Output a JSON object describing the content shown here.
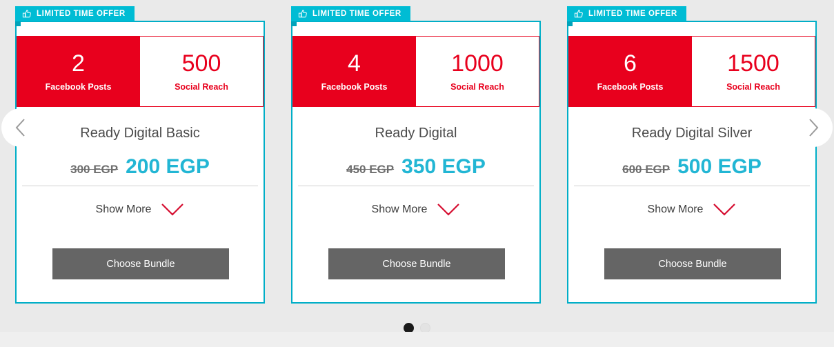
{
  "page": {
    "background_color": "#eaeaea",
    "accent_cyan": "#00aec7",
    "accent_red": "#e8001d",
    "price_color": "#22b6d4",
    "button_color": "#656565"
  },
  "carousel": {
    "prev_label": "Previous",
    "prev_icon": "chevron-left-icon",
    "next_label": "Next",
    "next_icon": "chevron-right-icon",
    "dots": [
      {
        "state": "active"
      },
      {
        "state": "inactive"
      }
    ]
  },
  "ribbon": {
    "label": "LIMITED TIME OFFER",
    "icon": "thumbs-up-icon",
    "background_color": "#00bcd4"
  },
  "cards": [
    {
      "posts_value": "2",
      "posts_label": "Facebook Posts",
      "reach_value": "500",
      "reach_label": "Social Reach",
      "title": "Ready Digital Basic",
      "price_old": "300 EGP",
      "price_new": "200 EGP",
      "show_more_label": "Show More",
      "show_more_icon": "chevron-down-icon",
      "cta_label": "Choose Bundle"
    },
    {
      "posts_value": "4",
      "posts_label": "Facebook Posts",
      "reach_value": "1000",
      "reach_label": "Social Reach",
      "title": "Ready Digital",
      "price_old": "450 EGP",
      "price_new": "350 EGP",
      "show_more_label": "Show More",
      "show_more_icon": "chevron-down-icon",
      "cta_label": "Choose Bundle"
    },
    {
      "posts_value": "6",
      "posts_label": "Facebook Posts",
      "reach_value": "1500",
      "reach_label": "Social Reach",
      "title": "Ready Digital Silver",
      "price_old": "600 EGP",
      "price_new": "500 EGP",
      "show_more_label": "Show More",
      "show_more_icon": "chevron-down-icon",
      "cta_label": "Choose Bundle"
    }
  ]
}
